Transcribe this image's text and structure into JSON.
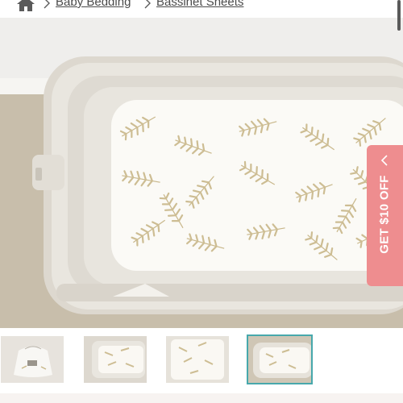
{
  "breadcrumb": {
    "home_icon": "home-icon",
    "separator_icon": "chevron-right-icon",
    "items": [
      {
        "label": "Baby Bedding"
      },
      {
        "label": "Bassinet Sheets"
      }
    ]
  },
  "promo": {
    "label": "GET $10 OFF",
    "icon": "chevron-left-icon",
    "color": "#ee8d8f"
  },
  "gallery": {
    "main_image": "bassinet-fern-sheet-photo",
    "thumbnails": [
      {
        "name": "sheet-in-drawstring-bag"
      },
      {
        "name": "bassinet-sheet-view-2"
      },
      {
        "name": "bassinet-sheet-view-3"
      },
      {
        "name": "bassinet-sheet-view-4",
        "selected": true
      }
    ],
    "selected_index": 3,
    "accent_color": "#47a8ac"
  }
}
